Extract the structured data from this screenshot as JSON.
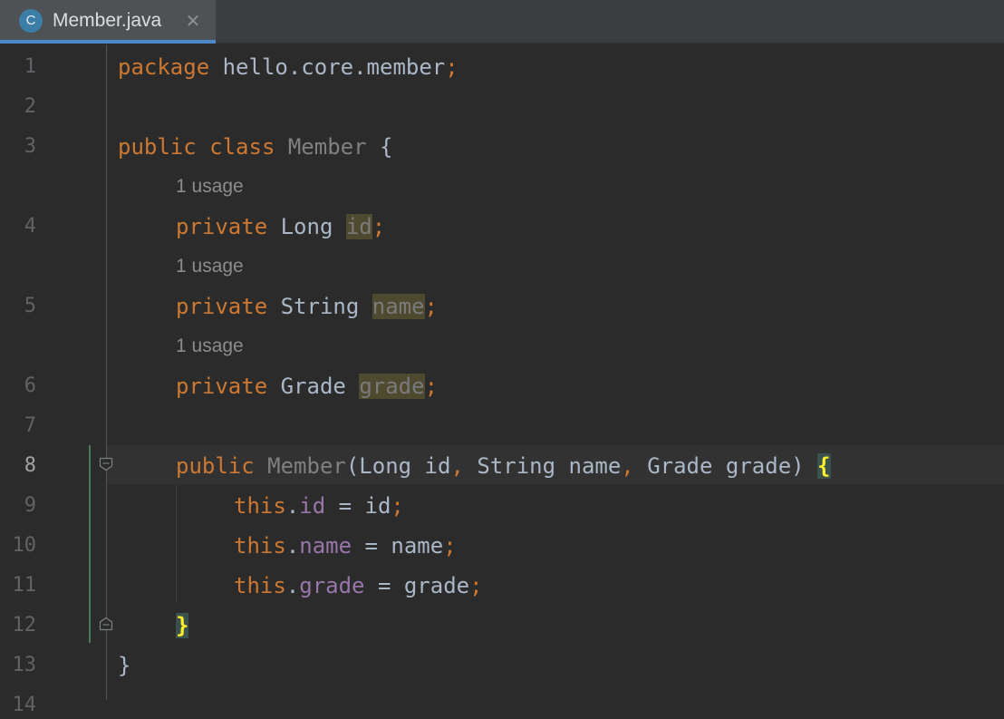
{
  "tab": {
    "icon_letter": "C",
    "label": "Member.java",
    "close_glyph": "✕"
  },
  "line_numbers": [
    "1",
    "2",
    "3",
    "4",
    "5",
    "6",
    "7",
    "8",
    "9",
    "10",
    "11",
    "12",
    "13",
    "14"
  ],
  "usage_hint": "1 usage",
  "code": {
    "l1_kw": "package",
    "l1_rest": " hello.core.member",
    "l1_semi": ";",
    "l3_kw1": "public",
    "l3_kw2": "class",
    "l3_name": "Member",
    "l3_brace": " {",
    "l4_kw": "private",
    "l4_type": " Long ",
    "l4_field": "id",
    "l4_semi": ";",
    "l5_kw": "private",
    "l5_type": " String ",
    "l5_field": "name",
    "l5_semi": ";",
    "l6_kw": "private",
    "l6_type": " Grade ",
    "l6_field": "grade",
    "l6_semi": ";",
    "l8_kw": "public",
    "l8_name": "Member",
    "l8_p1": "(Long id",
    "l8_c1": ",",
    "l8_p2": " String name",
    "l8_c2": ",",
    "l8_p3": " Grade grade) ",
    "l8_brace": "{",
    "l9_this": "this",
    "l9_dot": ".",
    "l9_field": "id",
    "l9_rest": " = id",
    "l9_semi": ";",
    "l10_this": "this",
    "l10_dot": ".",
    "l10_field": "name",
    "l10_rest": " = name",
    "l10_semi": ";",
    "l11_this": "this",
    "l11_dot": ".",
    "l11_field": "grade",
    "l11_rest": " = grade",
    "l11_semi": ";",
    "l12_brace": "}",
    "l13_brace": "}"
  },
  "colors": {
    "keyword": "#cc7832",
    "field": "#9876aa",
    "text": "#a9b7c6",
    "background": "#2b2b2b"
  }
}
